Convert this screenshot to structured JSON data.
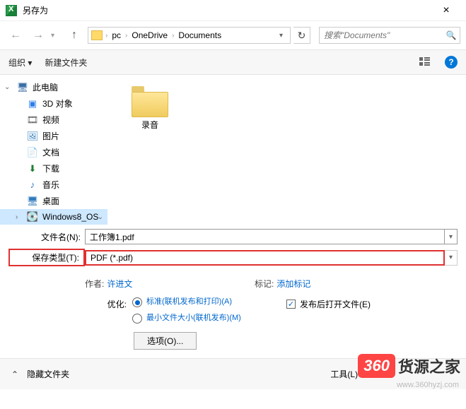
{
  "window": {
    "title": "另存为"
  },
  "breadcrumb": {
    "root": "pc",
    "mid": "OneDrive",
    "leaf": "Documents"
  },
  "search": {
    "placeholder": "搜索\"Documents\""
  },
  "toolbar": {
    "organize": "组织 ▾",
    "newfolder": "新建文件夹"
  },
  "sidebar": {
    "items": [
      {
        "label": "此电脑"
      },
      {
        "label": "3D 对象"
      },
      {
        "label": "视频"
      },
      {
        "label": "图片"
      },
      {
        "label": "文档"
      },
      {
        "label": "下载"
      },
      {
        "label": "音乐"
      },
      {
        "label": "桌面"
      },
      {
        "label": "Windows8_OS"
      }
    ]
  },
  "content": {
    "files": [
      {
        "name": "录音"
      }
    ]
  },
  "form": {
    "filename_label": "文件名(N):",
    "filename_value": "工作簿1.pdf",
    "filetype_label": "保存类型(T):",
    "filetype_value": "PDF (*.pdf)"
  },
  "meta": {
    "author_label": "作者:",
    "author_value": "许进文",
    "tags_label": "标记:",
    "tags_value": "添加标记"
  },
  "optimize": {
    "label": "优化:",
    "opt1": "标准(联机发布和打印)(A)",
    "opt2": "最小文件大小(联机发布)(M)",
    "openafter": "发布后打开文件(E)",
    "options_btn": "选项(O)..."
  },
  "footer": {
    "hide": "隐藏文件夹",
    "tools": "工具(L)"
  },
  "watermark": {
    "badge": "360",
    "text": "货源之家",
    "url": "www.360hyzj.com"
  }
}
